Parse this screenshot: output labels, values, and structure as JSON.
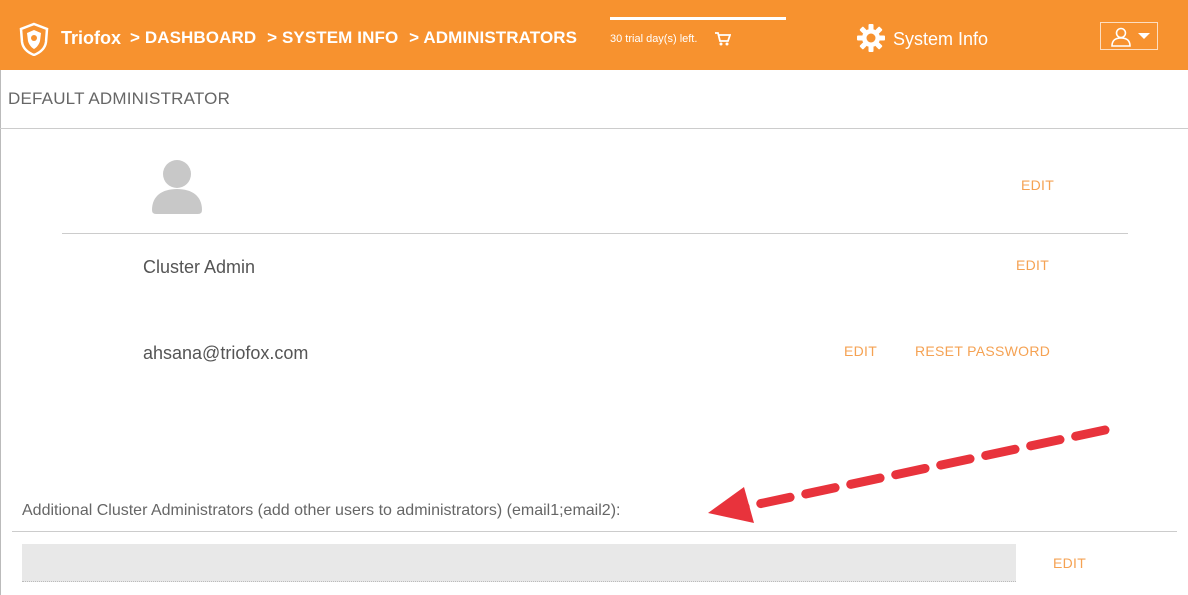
{
  "header": {
    "brand": "Triofox",
    "breadcrumbs": [
      "> DASHBOARD",
      "> SYSTEM INFO",
      "> ADMINISTRATORS"
    ],
    "trial_text": "30 trial day(s) left.",
    "page_name": "System Info",
    "icons": [
      "triofox-logo-icon",
      "cart-icon",
      "gear-icon",
      "user-icon"
    ]
  },
  "section": {
    "title": "DEFAULT ADMINISTRATOR"
  },
  "rows": {
    "avatar_edit": "EDIT",
    "name": "Cluster Admin",
    "name_edit": "EDIT",
    "email": "ahsana@triofox.com",
    "email_edit": "EDIT",
    "reset_password": "RESET PASSWORD"
  },
  "additional": {
    "label": "Additional Cluster Administrators (add other users to administrators) (email1;email2):",
    "value": "",
    "edit": "EDIT"
  },
  "colors": {
    "header_bg": "#f7922f",
    "link": "#f5a253",
    "annotation_arrow": "#e8333c"
  }
}
